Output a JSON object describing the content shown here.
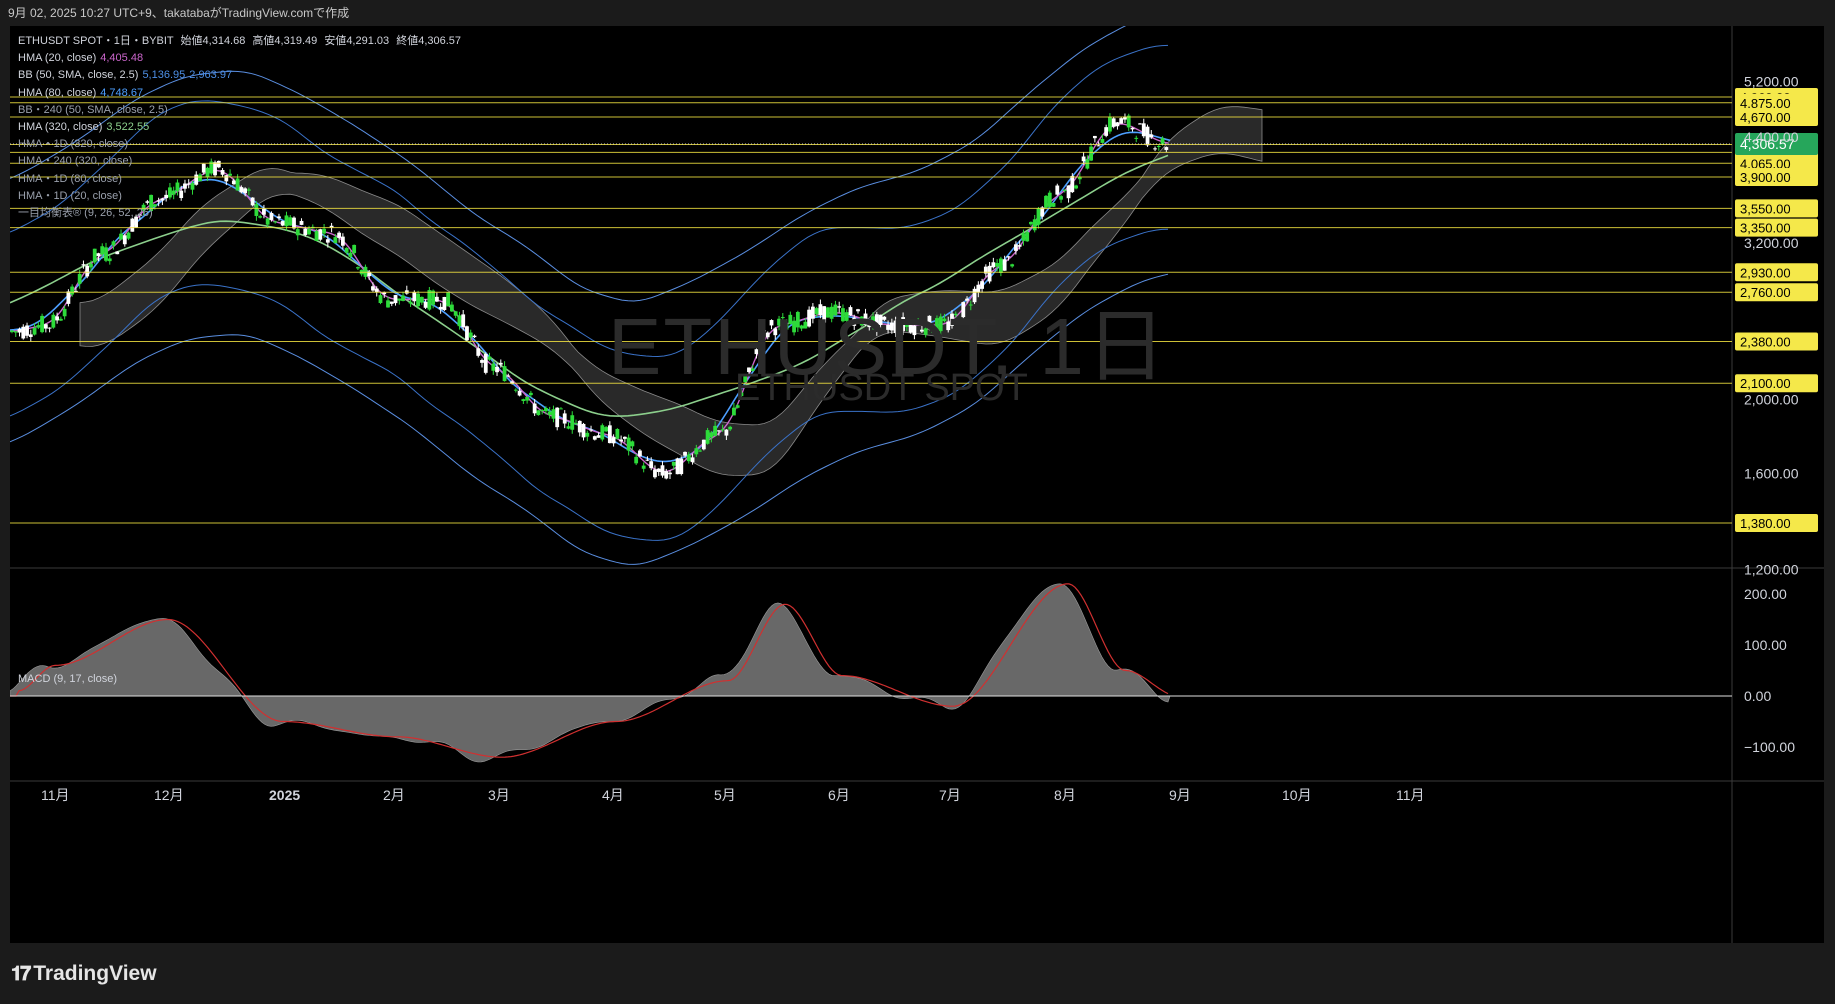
{
  "header": {
    "caption": "9月 02, 2025 10:27 UTC+9、takatabaがTradingView.comで作成"
  },
  "watermark": {
    "title": "ETHUSDT, 1日",
    "subtitle": "ETHUSDT SPOT"
  },
  "legend": {
    "symbol_line": {
      "symbol": "ETHUSDT SPOT・1日・BYBIT",
      "open_label": "始値",
      "open": "4,314.68",
      "high_label": "高値",
      "high": "4,319.49",
      "low_label": "安値",
      "low": "4,291.03",
      "close_label": "終値",
      "close": "4,306.57"
    },
    "indicators": [
      {
        "name": "HMA (20, close)",
        "value": "4,405.48",
        "color": "#cc66cc"
      },
      {
        "name": "BB (50, SMA, close, 2.5)",
        "value": "5,136.95",
        "value2": "2,963.97",
        "color": "#4d8fe6"
      },
      {
        "name": "HMA (80, close)",
        "value": "4,748.67",
        "color": "#4d9fff"
      },
      {
        "name": "BB・240 (50, SMA, close, 2.5)",
        "value": "",
        "color": ""
      },
      {
        "name": "HMA (320, close)",
        "value": "3,522.55",
        "color": "#8ccf8c"
      },
      {
        "name": "HMA・1D (320, close)",
        "value": "",
        "color": ""
      },
      {
        "name": "HMA・240 (320, close)",
        "value": "",
        "color": ""
      },
      {
        "name": "HMA・1D (80, close)",
        "value": "",
        "color": ""
      },
      {
        "name": "HMA・1D (20, close)",
        "value": "",
        "color": ""
      },
      {
        "name": "一目均衡表® (9, 26, 52, 26)",
        "value": "",
        "color": ""
      }
    ]
  },
  "macd_label": "MACD (9, 17, close)",
  "price_axis": {
    "ticks": [
      "5,200.00",
      "4,400.00",
      "3,200.00",
      "2,000.00",
      "1,600.00",
      "1,200.00"
    ],
    "levels": [
      "4,960.00",
      "4,875.00",
      "4,670.00",
      "4,300.00",
      "4,200.00",
      "4,065.00",
      "3,900.00",
      "3,550.00",
      "3,350.00",
      "2,930.00",
      "2,760.00",
      "2,380.00",
      "2,100.00",
      "1,380.00"
    ],
    "current_price": "4,306.57"
  },
  "macd_axis": {
    "ticks": [
      "200.00",
      "100.00",
      "0.00",
      "−100.00"
    ]
  },
  "time_axis": {
    "labels": [
      "11月",
      "12月",
      "2025",
      "2月",
      "3月",
      "4月",
      "5月",
      "6月",
      "7月",
      "8月",
      "9月",
      "10月",
      "11月"
    ]
  },
  "branding": {
    "name": "TradingView"
  },
  "colors": {
    "level_line": "#f0e040",
    "level_tag_bg": "#f5e84a",
    "current_tag_bg": "#26a65b",
    "up_candle": "#2ddb3a",
    "down_candle": "#ffffff",
    "hma20": "#cc66cc",
    "hma80": "#4d9fff",
    "hma320": "#8ccf8c",
    "bb": "#3a72c8",
    "bb240": "#5a8ee0",
    "cloud": "#4a4a4a",
    "macd_line": "#d03030",
    "macd_area": "#7a7a7a"
  },
  "chart_data": {
    "type": "candlestick",
    "symbol": "ETHUSDT SPOT",
    "interval": "1日",
    "exchange": "BYBIT",
    "ohlc_last": {
      "open": 4314.68,
      "high": 4319.49,
      "low": 4291.03,
      "close": 4306.57
    },
    "horizontal_levels": [
      4960,
      4875,
      4670,
      4300,
      4200,
      4065,
      3900,
      3550,
      3350,
      2930,
      2760,
      2380,
      2100,
      1380
    ],
    "price_series_approx": [
      {
        "month": "11月",
        "price": 2500
      },
      {
        "month": "11月 mid",
        "price": 3100
      },
      {
        "month": "12月",
        "price": 3650
      },
      {
        "month": "12月 mid",
        "price": 4000
      },
      {
        "month": "2025",
        "price": 3400
      },
      {
        "month": "2025 mid",
        "price": 3300
      },
      {
        "month": "2月",
        "price": 2700
      },
      {
        "month": "2月 mid",
        "price": 2700
      },
      {
        "month": "3月",
        "price": 2200
      },
      {
        "month": "3月 mid",
        "price": 1900
      },
      {
        "month": "4月",
        "price": 1800
      },
      {
        "month": "4月 mid",
        "price": 1600
      },
      {
        "month": "5月",
        "price": 1800
      },
      {
        "month": "5月 mid",
        "price": 2500
      },
      {
        "month": "6月",
        "price": 2600
      },
      {
        "month": "6月 mid",
        "price": 2500
      },
      {
        "month": "7月",
        "price": 2500
      },
      {
        "month": "7月 mid",
        "price": 3000
      },
      {
        "month": "8月",
        "price": 3700
      },
      {
        "month": "8月 mid",
        "price": 4600
      },
      {
        "month": "9月",
        "price": 4306.57
      }
    ],
    "macd": {
      "params": "9, 17, close",
      "values_approx": [
        {
          "month": "11月",
          "value": 60
        },
        {
          "month": "12月",
          "value": 150
        },
        {
          "month": "2025",
          "value": -50
        },
        {
          "month": "2月",
          "value": -80
        },
        {
          "month": "3月",
          "value": -120
        },
        {
          "month": "4月",
          "value": -50
        },
        {
          "month": "5月",
          "value": 30
        },
        {
          "month": "5月 mid",
          "value": 180
        },
        {
          "month": "6月",
          "value": 40
        },
        {
          "month": "7月",
          "value": -20
        },
        {
          "month": "8月",
          "value": 220
        },
        {
          "month": "8月 mid",
          "value": 50
        },
        {
          "month": "9月",
          "value": 0
        }
      ]
    },
    "legend_placement": "top-left"
  }
}
